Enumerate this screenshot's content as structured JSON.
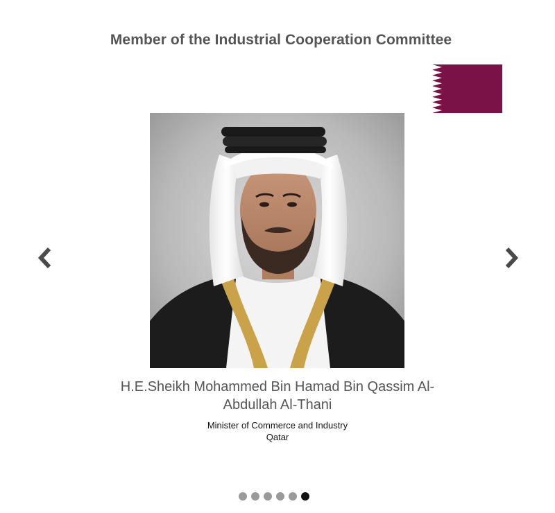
{
  "carousel": {
    "title": "Member of the Industrial Cooperation Committee",
    "member": {
      "name": "H.E.Sheikh Mohammed Bin Hamad Bin Qassim Al-Abdullah Al-Thani",
      "name_line1": "H.E.Sheikh Mohammed Bin Hamad Bin Qassim Al-",
      "name_line2": "Abdullah Al-Thani",
      "position": "Minister of Commerce and Industry",
      "country": "Qatar"
    },
    "flag_icon": "qatar-flag-icon",
    "prev_icon": "chevron-left-icon",
    "next_icon": "chevron-right-icon",
    "pagination": {
      "total": 6,
      "active_index": 5
    }
  },
  "colors": {
    "flag_maroon": "#7a1248",
    "heading_text": "#555555",
    "arrow": "#4a4a4a",
    "dot_inactive": "#9a9a9a",
    "dot_active": "#111111"
  }
}
